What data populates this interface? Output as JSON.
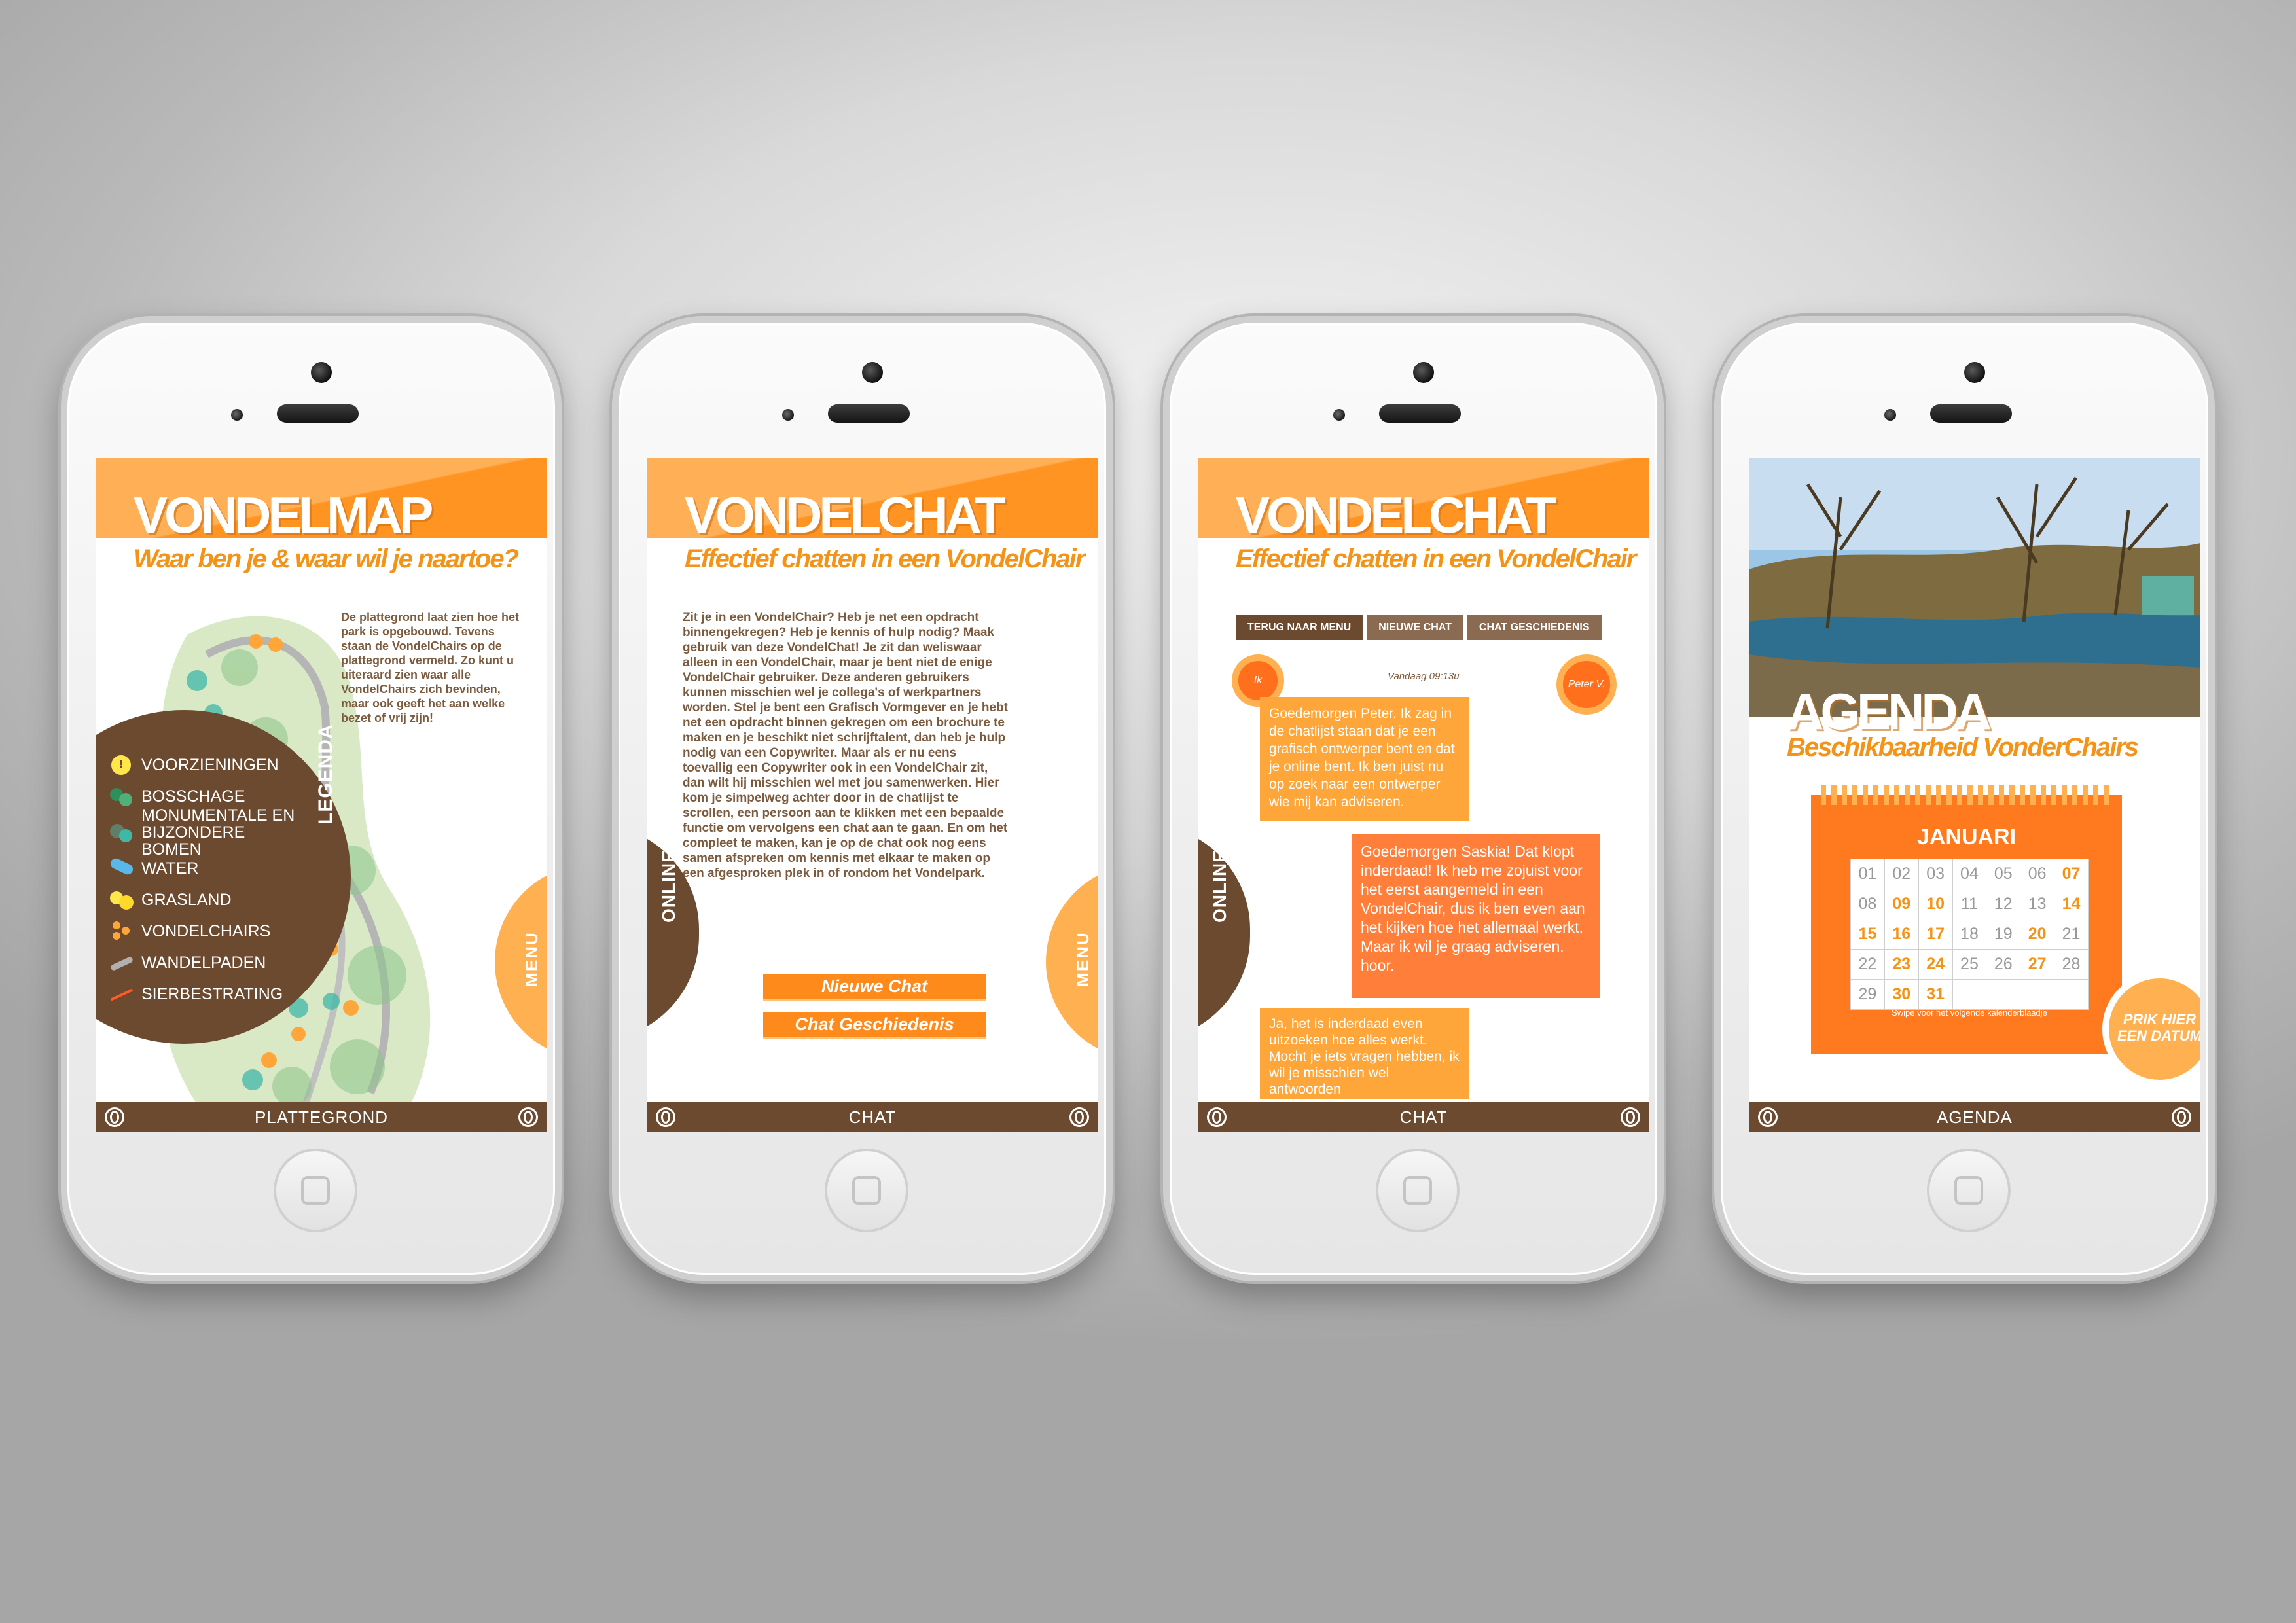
{
  "phones": [
    {
      "title": "VONDELMAP",
      "subtitle": "Waar ben je & waar wil je naartoe?",
      "intro": "De plattegrond laat zien hoe het park is opgebouwd. Tevens staan de VondelChairs op de plattegrond vermeld. Zo kunt u uiteraard zien waar alle VondelChairs zich bevinden, maar ook geeft het aan welke bezet of vrij zijn!",
      "legend_title": "LEGENDA",
      "legend": [
        {
          "icon": "info-icon",
          "label": "VOORZIENINGEN"
        },
        {
          "icon": "bush-icon",
          "label": "BOSSCHAGE"
        },
        {
          "icon": "tree-icon",
          "label": "MONUMENTALE EN BIJZONDERE BOMEN"
        },
        {
          "icon": "water-icon",
          "label": "WATER"
        },
        {
          "icon": "grass-icon",
          "label": "GRASLAND"
        },
        {
          "icon": "chair-icon",
          "label": "VONDELCHAIRS"
        },
        {
          "icon": "path-icon",
          "label": "WANDELPADEN"
        },
        {
          "icon": "decor-path-icon",
          "label": "SIERBESTRATING"
        }
      ],
      "side_tab": "MENU",
      "footer": "PLATTEGROND"
    },
    {
      "title": "VONDELCHAT",
      "subtitle": "Effectief chatten in een VondelChair",
      "body": "Zit je in een VondelChair? Heb je net een opdracht binnengekregen? Heb je kennis of hulp nodig? Maak gebruik van deze VondelChat! Je zit dan weliswaar alleen in een VondelChair, maar je bent niet de enige VondelChair gebruiker. Deze anderen gebruikers kunnen misschien wel je collega's of werkpartners worden. Stel je bent een Grafisch Vormgever en je hebt net een opdracht binnen gekregen om een brochure te maken en je beschikt niet schrijftalent, dan heb je hulp nodig van een Copywriter. Maar als er nu eens toevallig een Copywriter ook in een VondelChair zit, dan wilt hij misschien wel met jou samenwerken. Hier kom je simpelweg achter door in de chatlijst te scrollen, een persoon aan te klikken met een bepaalde functie om vervolgens een chat aan te gaan. En om het compleet te maken, kan je op de chat ook nog eens samen afspreken om kennis met elkaar te maken op een afgesproken plek in of rondom het Vondelpark.",
      "btn_new": "Nieuwe Chat",
      "btn_history": "Chat Geschiedenis",
      "online_tab": "ONLINE",
      "side_tab": "MENU",
      "footer": "CHAT"
    },
    {
      "title": "VONDELCHAT",
      "subtitle": "Effectief chatten in een VondelChair",
      "nav": [
        "TERUG NAAR MENU",
        "NIEUWE CHAT",
        "CHAT GESCHIEDENIS"
      ],
      "me": "Ik",
      "other": "Peter V.",
      "timestamp": "Vandaag 09:13u",
      "messages": [
        "Goedemorgen Peter. Ik zag in de chatlijst staan dat je een grafisch ontwerper bent en dat je online bent. Ik ben juist nu op zoek naar een ontwerper wie mij kan adviseren.",
        "Goedemorgen Saskia! Dat klopt inderdaad! Ik heb me zojuist voor het eerst aangemeld in een VondelChair, dus ik ben even aan het kijken hoe het allemaal werkt. Maar ik wil je graag adviseren. hoor.",
        "Ja, het is inderdaad even uitzoeken hoe alles werkt. Mocht je iets vragen hebben, ik wil je misschien wel antwoorden"
      ],
      "online_tab": "ONLINE",
      "footer": "CHAT"
    },
    {
      "title": "AGENDA",
      "subtitle": "Beschikbaarheid VonderChairs",
      "month": "JANUARI",
      "days": [
        [
          "01",
          "02",
          "03",
          "04",
          "05",
          "06",
          "07"
        ],
        [
          "08",
          "09",
          "10",
          "11",
          "12",
          "13",
          "14"
        ],
        [
          "15",
          "16",
          "17",
          "18",
          "19",
          "20",
          "21"
        ],
        [
          "22",
          "23",
          "24",
          "25",
          "26",
          "27",
          "28"
        ],
        [
          "29",
          "30",
          "31",
          "",
          "",
          "",
          ""
        ]
      ],
      "highlighted": [
        "07",
        "09",
        "10",
        "14",
        "15",
        "16",
        "17",
        "20",
        "23",
        "24",
        "27",
        "30",
        "31"
      ],
      "swipe_hint": "Swipe voor het volgende kalenderblaadje",
      "prik_line1": "PRIK HIER",
      "prik_line2": "EEN DATUM",
      "footer": "AGENDA"
    }
  ],
  "colors": {
    "orange": "#ff9422",
    "light_orange": "#ffb152",
    "brown": "#6b4a2f",
    "text_brown": "#7b5a3d"
  }
}
